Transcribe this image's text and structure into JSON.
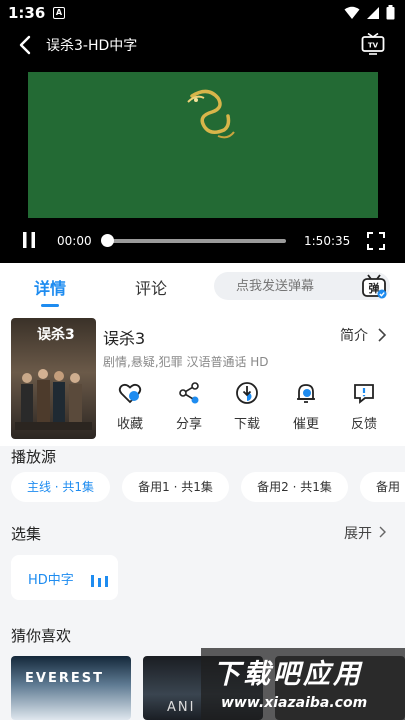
{
  "status": {
    "time": "1:36",
    "notif_badge": "A"
  },
  "header": {
    "title": "误杀3-HD中字"
  },
  "player": {
    "current_time": "00:00",
    "duration": "1:50:35",
    "progress": 0.0
  },
  "tabs": {
    "detail": "详情",
    "comment": "评论"
  },
  "danmu": {
    "placeholder": "点我发送弹幕",
    "badge": "弹"
  },
  "movie": {
    "poster_title": "误杀3",
    "title": "误杀3",
    "intro_label": "简介",
    "meta": "剧情,悬疑,犯罪 汉语普通话 HD"
  },
  "actions": [
    {
      "label": "收藏",
      "icon": "heart-icon"
    },
    {
      "label": "分享",
      "icon": "share-icon"
    },
    {
      "label": "下载",
      "icon": "download-icon"
    },
    {
      "label": "催更",
      "icon": "bell-icon"
    },
    {
      "label": "反馈",
      "icon": "feedback-icon"
    }
  ],
  "source_section": {
    "title": "播放源",
    "items": [
      "主线 · 共1集",
      "备用1 · 共1集",
      "备用2 · 共1集",
      "备用"
    ]
  },
  "episode_section": {
    "title": "选集",
    "expand": "展开",
    "episode": "HD中字"
  },
  "recommend_section": {
    "title": "猜你喜欢",
    "items": [
      "EVEREST",
      "ANI"
    ]
  },
  "watermark": {
    "main": "下载吧应用",
    "url": "www.xiazaiba.com"
  },
  "colors": {
    "accent": "#1e8cf0",
    "video_bg": "#236a34"
  }
}
